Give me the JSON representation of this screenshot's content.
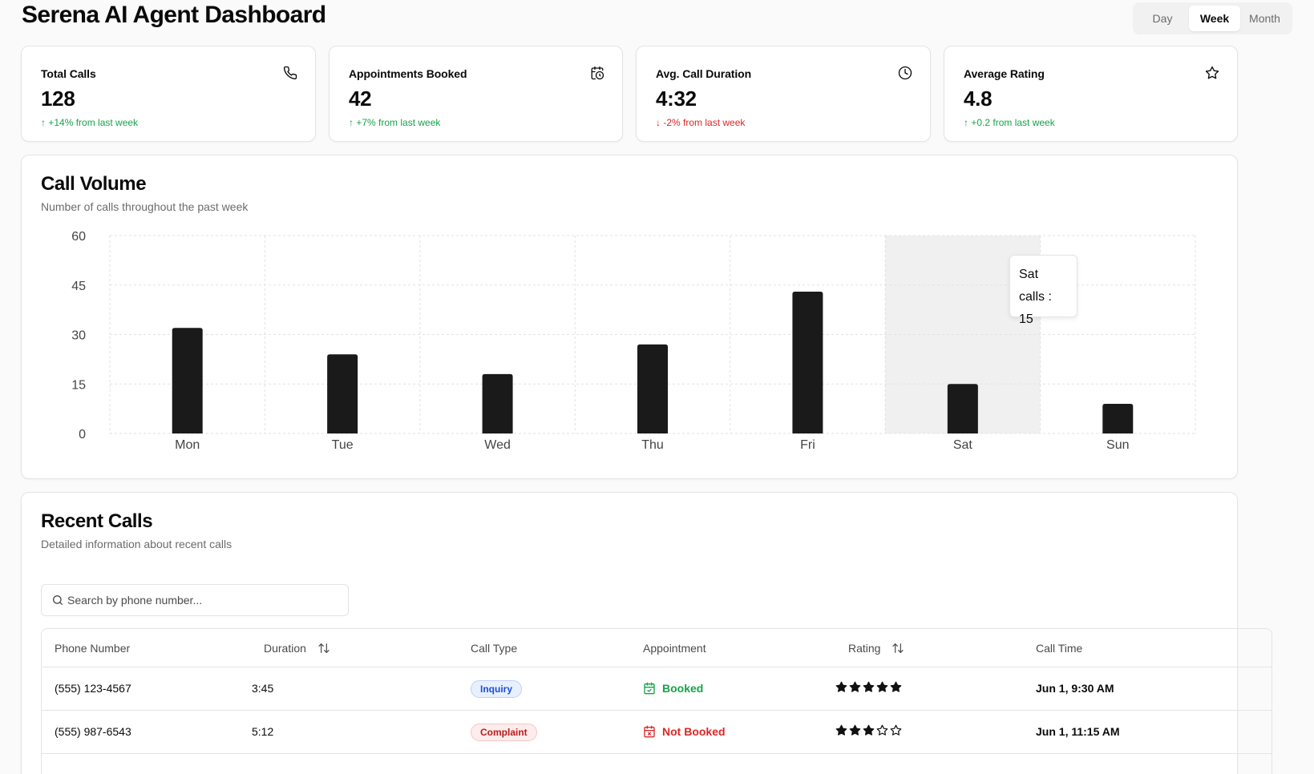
{
  "header": {
    "title": "Serena AI Agent Dashboard",
    "range_options": [
      "Day",
      "Week",
      "Month"
    ],
    "selected_range": "Week"
  },
  "stats": [
    {
      "title": "Total Calls",
      "value": "128",
      "delta": "+14% from last week",
      "trend": "up",
      "icon": "phone-icon"
    },
    {
      "title": "Appointments Booked",
      "value": "42",
      "delta": "+7% from last week",
      "trend": "up",
      "icon": "calendar-clock-icon"
    },
    {
      "title": "Avg. Call Duration",
      "value": "4:32",
      "delta": "-2% from last week",
      "trend": "down",
      "icon": "clock-icon"
    },
    {
      "title": "Average Rating",
      "value": "4.8",
      "delta": "+0.2 from last week",
      "trend": "up",
      "icon": "star-icon"
    }
  ],
  "call_volume": {
    "title": "Call Volume",
    "subtitle": "Number of calls throughout the past week",
    "tooltip": {
      "label": "Sat",
      "text": "calls : 15"
    }
  },
  "chart_data": {
    "type": "bar",
    "categories": [
      "Mon",
      "Tue",
      "Wed",
      "Thu",
      "Fri",
      "Sat",
      "Sun"
    ],
    "values": [
      32,
      24,
      18,
      27,
      43,
      15,
      9
    ],
    "ylim": [
      0,
      60
    ],
    "yticks": [
      0,
      15,
      30,
      45,
      60
    ],
    "grid": true,
    "highlighted": "Sat",
    "bar_color": "#1a1a1a"
  },
  "recent_calls": {
    "title": "Recent Calls",
    "subtitle": "Detailed information about recent calls",
    "search_placeholder": "Search by phone number...",
    "columns": [
      "Phone Number",
      "Duration",
      "Call Type",
      "Appointment",
      "Rating",
      "Call Time"
    ],
    "rows": [
      {
        "phone": "(555) 123-4567",
        "duration": "3:45",
        "type": "Inquiry",
        "appointment": "Booked",
        "rating": 5,
        "time": "Jun 1, 9:30 AM"
      },
      {
        "phone": "(555) 987-6543",
        "duration": "5:12",
        "type": "Complaint",
        "appointment": "Not Booked",
        "rating": 3,
        "time": "Jun 1, 11:15 AM"
      }
    ]
  }
}
